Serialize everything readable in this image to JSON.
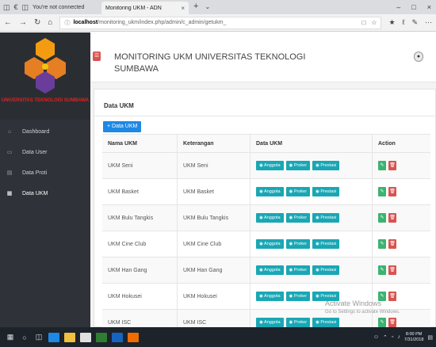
{
  "browser": {
    "security_warning": "You're not connected",
    "tab_title": "Monitoring UKM - ADN",
    "url_host": "localhost",
    "url_path": "/monitoring_ukm/index.php/admin/c_admin/getukm_"
  },
  "sidebar": {
    "logo_text": "UNIVERSITAS TEKNOLOGI SUMBAWA",
    "items": [
      {
        "label": "Dashboard",
        "icon": "home-icon"
      },
      {
        "label": "Data User",
        "icon": "monitor-icon"
      },
      {
        "label": "Data Proti",
        "icon": "list-icon"
      },
      {
        "label": "Data UKM",
        "icon": "grid-icon"
      }
    ]
  },
  "header": {
    "title": "MONITORING UKM UNIVERSITAS TEKNOLOGI SUMBAWA"
  },
  "panel": {
    "title": "Data UKM",
    "add_button": "+ Data UKM"
  },
  "table": {
    "headers": [
      "Nama UKM",
      "Keterangan",
      "Data UKM",
      "Action"
    ],
    "button_labels": [
      "◉ Anggota",
      "◉ Proker",
      "◉ Prestasi"
    ],
    "rows": [
      {
        "nama": "UKM Seni",
        "keterangan": "UKM Seni"
      },
      {
        "nama": "UKM Basket",
        "keterangan": "UKM Basket"
      },
      {
        "nama": "UKM Bulu Tangkis",
        "keterangan": "UKM Bulu Tangkis"
      },
      {
        "nama": "UKM Cine Club",
        "keterangan": "UKM Cine Club"
      },
      {
        "nama": "UKM Han Gang",
        "keterangan": "UKM Han Gang"
      },
      {
        "nama": "UKM Hokusei",
        "keterangan": "UKM Hokusei"
      },
      {
        "nama": "UKM ISC",
        "keterangan": "UKM ISC"
      }
    ]
  },
  "watermark": {
    "line1": "Activate Windows",
    "line2": "Go to Settings to activate Windows."
  },
  "taskbar": {
    "time": "8:00 PM",
    "date": "7/31/2018"
  },
  "colors": {
    "sidebar_bg": "#2f3339",
    "accent_blue": "#1e88e5",
    "teal_button": "#19a7b5",
    "edit_green": "#3cb371",
    "delete_red": "#d9534f"
  }
}
